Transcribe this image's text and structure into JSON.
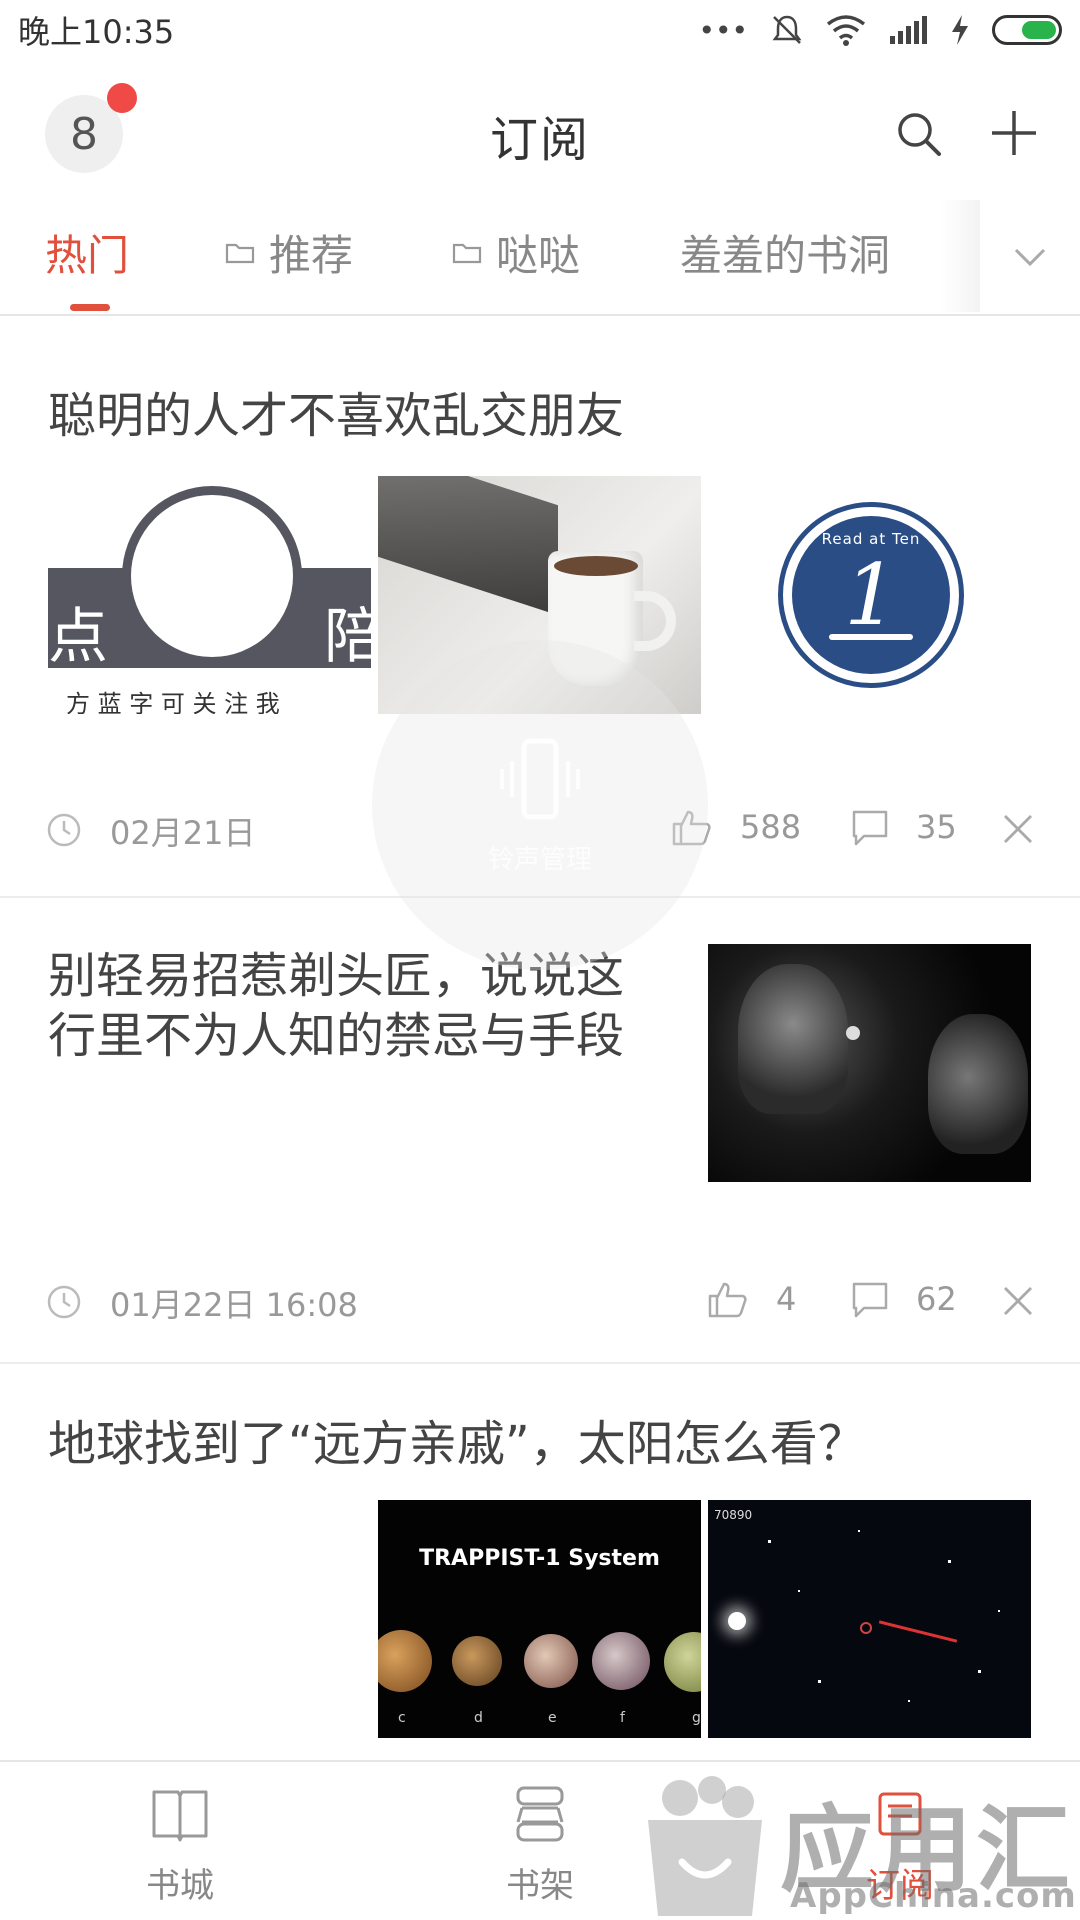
{
  "status_bar": {
    "time": "晚上10:35",
    "dots": "•••"
  },
  "header": {
    "title": "订阅",
    "avatar_text": "8"
  },
  "tabs": [
    {
      "label": "热门",
      "active": true
    },
    {
      "label": "推荐",
      "has_folder": true
    },
    {
      "label": "哒哒",
      "has_folder": true
    },
    {
      "label": "羞羞的书洞"
    }
  ],
  "articles": [
    {
      "title": "聪明的人才不喜欢乱交朋友",
      "thumb1_text_left": "点",
      "thumb1_text_right": "陪",
      "thumb1_caption": "方 蓝 字 可 关 注 我",
      "thumb3_badge": "Read at Ten",
      "thumb3_number": "1",
      "date": "02月21日",
      "likes": "588",
      "comments": "35"
    },
    {
      "title_line1": "别轻易招惹剃头匠，说说这",
      "title_line2": "行里不为人知的禁忌与手段",
      "date": "01月22日 16:08",
      "likes": "4",
      "comments": "62"
    },
    {
      "title": "地球找到了“远方亲戚”，太阳怎么看？",
      "thumb1_caption": "TRAPPIST-1 System",
      "planet_labels": [
        "c",
        "d",
        "e",
        "f",
        "g"
      ],
      "thumb2_corner": "70890"
    }
  ],
  "ring_overlay": {
    "text": "铃声管理"
  },
  "bottom_nav": [
    {
      "label": "书城"
    },
    {
      "label": "书架"
    },
    {
      "label": "订阅",
      "active": true
    }
  ],
  "watermark": {
    "brand": "应用汇",
    "site": "AppChina.com"
  },
  "colors": {
    "accent": "#e0503c",
    "badge_red": "#f04a47"
  }
}
